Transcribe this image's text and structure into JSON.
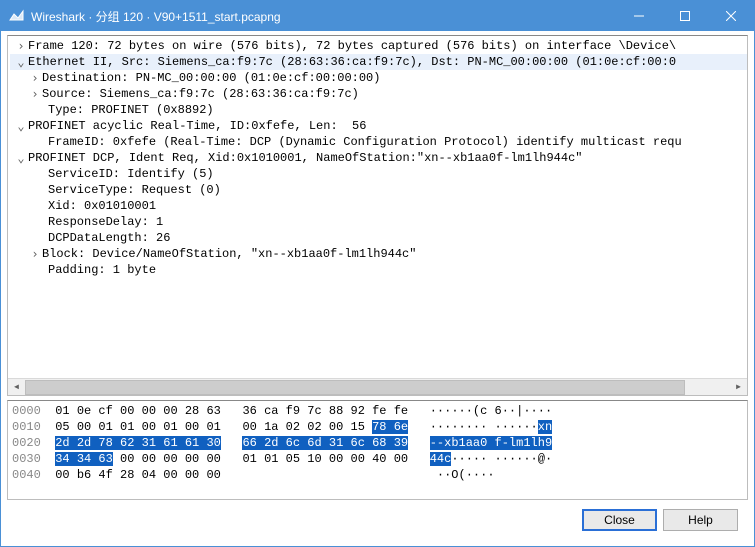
{
  "window": {
    "title": "Wireshark · 分组 120 · V90+1511_start.pcapng"
  },
  "tree": {
    "frame": "Frame 120: 72 bytes on wire (576 bits), 72 bytes captured (576 bits) on interface \\Device\\",
    "eth": "Ethernet II, Src: Siemens_ca:f9:7c (28:63:36:ca:f9:7c), Dst: PN-MC_00:00:00 (01:0e:cf:00:0",
    "eth_dst": "Destination: PN-MC_00:00:00 (01:0e:cf:00:00:00)",
    "eth_src": "Source: Siemens_ca:f9:7c (28:63:36:ca:f9:7c)",
    "eth_type": "Type: PROFINET (0x8892)",
    "pn_rt": "PROFINET acyclic Real-Time, ID:0xfefe, Len:  56",
    "pn_rt_fid": "FrameID: 0xfefe (Real-Time: DCP (Dynamic Configuration Protocol) identify multicast requ",
    "pn_dcp": "PROFINET DCP, Ident Req, Xid:0x1010001, NameOfStation:\"xn--xb1aa0f-lm1lh944c\"",
    "dcp_sid": "ServiceID: Identify (5)",
    "dcp_stype": "ServiceType: Request (0)",
    "dcp_xid": "Xid: 0x01010001",
    "dcp_delay": "ResponseDelay: 1",
    "dcp_len": "DCPDataLength: 26",
    "dcp_block": "Block: Device/NameOfStation, \"xn--xb1aa0f-lm1lh944c\"",
    "dcp_pad": "Padding: 1 byte"
  },
  "hex": {
    "r0": {
      "off": "0000",
      "h1": "01 0e cf 00 00 00 28 63",
      "h2": "36 ca f9 7c 88 92 fe fe",
      "a": "······(c 6··|····"
    },
    "r1": {
      "off": "0010",
      "h1": "05 00 01 01 00 01 00 01",
      "h2a": "00 1a 02 02 00 15 ",
      "h2b": "78 6e",
      "a1": "········ ······",
      "a2": "xn"
    },
    "r2": {
      "off": "0020",
      "h1": "2d 2d 78 62 31 61 61 30",
      "h2": "66 2d 6c 6d 31 6c 68 39",
      "a": "--xb1aa0 f-lm1lh9"
    },
    "r3": {
      "off": "0030",
      "h1a": "34 34 63",
      "h1b": " 00 00 00 00 00",
      "h2": "01 01 05 10 00 00 40 00",
      "a1": "44c",
      "a2": "····· ······@·"
    },
    "r4": {
      "off": "0040",
      "h1": "00 b6 4f 28 04 00 00 00",
      "h2": "",
      "a": "··O(···· "
    }
  },
  "buttons": {
    "close": "Close",
    "help": "Help"
  }
}
